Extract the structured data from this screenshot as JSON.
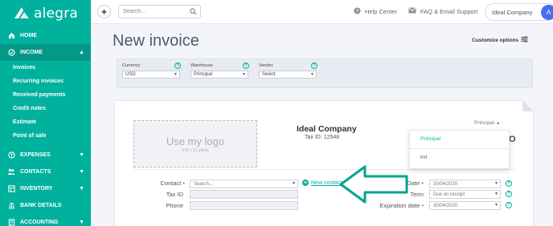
{
  "brand": {
    "name": "alegra",
    "accent": "#00b19d"
  },
  "sidebar": {
    "items": [
      {
        "label": "HOME",
        "icon": "home-icon"
      },
      {
        "label": "INCOME",
        "icon": "income-icon",
        "expanded": true,
        "children": [
          "Invoices",
          "Recurring invoices",
          "Received payments",
          "Credit notes",
          "Estimate",
          "Point of sale"
        ]
      },
      {
        "label": "EXPENSES",
        "icon": "expenses-icon"
      },
      {
        "label": "CONTACTS",
        "icon": "contacts-icon"
      },
      {
        "label": "INVENTORY",
        "icon": "inventory-icon"
      },
      {
        "label": "BANK DETAILS",
        "icon": "bank-icon"
      },
      {
        "label": "ACCOUNTING",
        "icon": "accounting-icon"
      }
    ]
  },
  "topbar": {
    "plus_label": "+",
    "search_placeholder": "Search...",
    "help_label": "Help Center",
    "faq_label": "FAQ & Email Support",
    "company_label": "Ideal Company",
    "avatar_letter": "A"
  },
  "page": {
    "title": "New invoice",
    "customize_label": "Customize options"
  },
  "filters": {
    "currency": {
      "label": "Currency",
      "value": "USD"
    },
    "warehouse": {
      "label": "Warehouse",
      "value": "Principal"
    },
    "vendor": {
      "label": "Vendor",
      "value": "Select"
    }
  },
  "invoice": {
    "logo_text": "Use my logo",
    "logo_hint": "178 x 51 pixels",
    "company_name": "Ideal Company",
    "tax_id": "Tax ID: 12548",
    "numbering": "Principal",
    "numbering_options": [
      "Principal",
      "rrrr"
    ],
    "cut_letter": "O",
    "contact": {
      "label": "Contact",
      "placeholder": "Search...",
      "new_contact": "New contact"
    },
    "tax_field": {
      "label": "Tax ID"
    },
    "phone_field": {
      "label": "Phone"
    },
    "date": {
      "label": "Date",
      "value": "30/04/2020"
    },
    "term": {
      "label": "Term",
      "value": "Due on receipt"
    },
    "expiration": {
      "label": "Expiration date",
      "value": "30/04/2020"
    }
  }
}
